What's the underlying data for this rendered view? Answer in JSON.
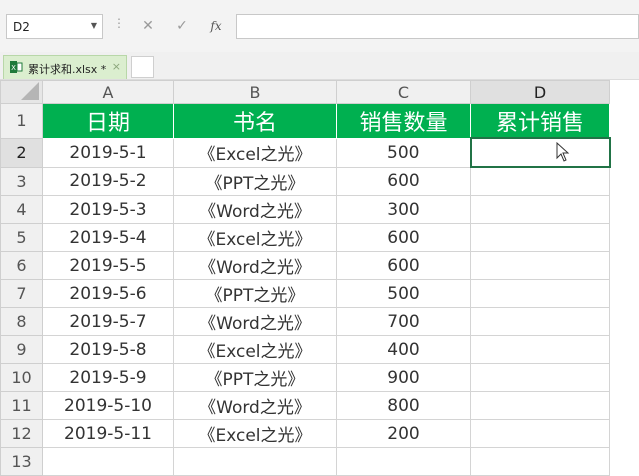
{
  "name_box": {
    "value": "D2"
  },
  "formula": {
    "fx_label": "fx",
    "cancel_icon": "cancel-icon",
    "enter_icon": "check-icon",
    "value": ""
  },
  "file_tab": {
    "label": "累计求和.xlsx *",
    "close_glyph": "×",
    "icon": "spreadsheet-file-icon",
    "accent": "#dbeecf"
  },
  "columns": [
    "A",
    "B",
    "C",
    "D"
  ],
  "active_cell": "D2",
  "header_fill": "#00b050",
  "table": {
    "headers": [
      "日期",
      "书名",
      "销售数量",
      "累计销售"
    ],
    "rows": [
      [
        "2019-5-1",
        "《Excel之光》",
        "500",
        ""
      ],
      [
        "2019-5-2",
        "《PPT之光》",
        "600",
        ""
      ],
      [
        "2019-5-3",
        "《Word之光》",
        "300",
        ""
      ],
      [
        "2019-5-4",
        "《Excel之光》",
        "600",
        ""
      ],
      [
        "2019-5-5",
        "《Word之光》",
        "600",
        ""
      ],
      [
        "2019-5-6",
        "《PPT之光》",
        "500",
        ""
      ],
      [
        "2019-5-7",
        "《Word之光》",
        "700",
        ""
      ],
      [
        "2019-5-8",
        "《Excel之光》",
        "400",
        ""
      ],
      [
        "2019-5-9",
        "《PPT之光》",
        "900",
        ""
      ],
      [
        "2019-5-10",
        "《Word之光》",
        "800",
        ""
      ],
      [
        "2019-5-11",
        "《Excel之光》",
        "200",
        ""
      ]
    ]
  },
  "row_numbers": [
    "1",
    "2",
    "3",
    "4",
    "5",
    "6",
    "7",
    "8",
    "9",
    "10",
    "11",
    "12",
    "13"
  ]
}
